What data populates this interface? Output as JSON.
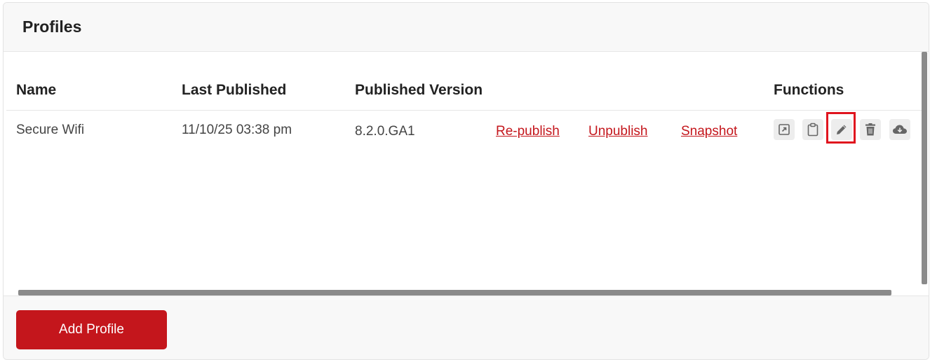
{
  "panel": {
    "title": "Profiles"
  },
  "table": {
    "columns": {
      "name": "Name",
      "last_published": "Last Published",
      "published_version": "Published Version",
      "functions": "Functions"
    },
    "rows": [
      {
        "name": "Secure Wifi",
        "last_published": "11/10/25 03:38 pm",
        "published_version": "8.2.0.GA1",
        "actions": {
          "republish": "Re-publish",
          "unpublish": "Unpublish",
          "snapshot": "Snapshot"
        },
        "functions": [
          {
            "icon": "open-external-icon"
          },
          {
            "icon": "clipboard-icon"
          },
          {
            "icon": "pencil-icon",
            "highlighted": true
          },
          {
            "icon": "trash-icon"
          },
          {
            "icon": "cloud-download-icon"
          }
        ]
      }
    ]
  },
  "footer": {
    "add_button_label": "Add Profile"
  },
  "colors": {
    "brand_red": "#c4161c",
    "highlight_red": "#e0141e",
    "header_bg": "#f8f8f8",
    "icon_bg": "#ededed",
    "icon_fg": "#666666"
  }
}
